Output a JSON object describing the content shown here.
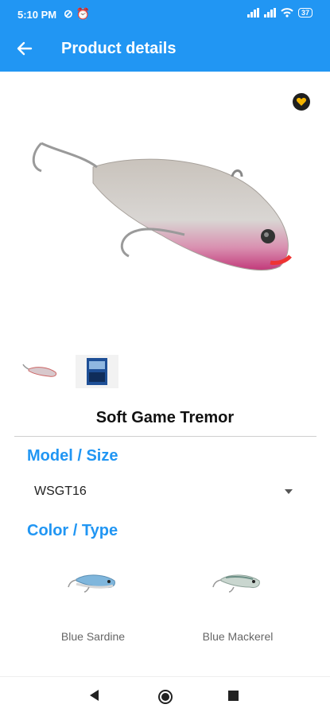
{
  "status": {
    "time": "5:10 PM",
    "battery": "37",
    "icons": [
      "dnd-icon",
      "alarm-icon",
      "signal-icon",
      "signal-icon",
      "wifi-icon",
      "battery-icon"
    ]
  },
  "appbar": {
    "title": "Product details",
    "back_icon": "arrow-left-icon"
  },
  "colors": {
    "primary": "#2196F3",
    "favorite": "#F5B400"
  },
  "product": {
    "name": "Soft Game Tremor",
    "images": [
      "lure-photo",
      "package-photo"
    ],
    "favorite_icon": "heart-icon"
  },
  "model": {
    "heading": "Model / Size",
    "selected": "WSGT16"
  },
  "color_type": {
    "heading": "Color / Type",
    "variants": [
      {
        "label": "Blue Sardine"
      },
      {
        "label": "Blue Mackerel"
      }
    ]
  },
  "navbar": {
    "icons": [
      "back-triangle-icon",
      "home-circle-icon",
      "recents-square-icon"
    ]
  }
}
